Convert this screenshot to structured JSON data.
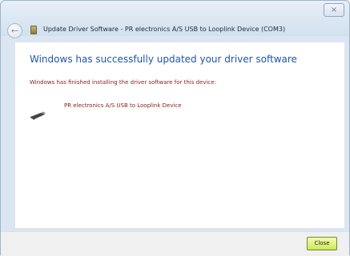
{
  "window": {
    "title": "Update Driver Software - PR electronics A/S USB to Looplink Device (COM3)",
    "close_glyph": "×"
  },
  "toolbar": {
    "back_glyph": "←",
    "back_icon": "back-arrow-icon",
    "driver_icon": "driver-software-icon"
  },
  "content": {
    "heading": "Windows has successfully updated your driver software",
    "message": "Windows has finished installing the driver software for this device:",
    "device_icon": "usb-device-icon",
    "device_name": "PR electronics A/S USB to Looplink Device"
  },
  "footer": {
    "close_label": "Close"
  },
  "colors": {
    "heading": "#1e56a8",
    "message_text": "#8a1c1c",
    "close_button": "#cfe85a"
  }
}
